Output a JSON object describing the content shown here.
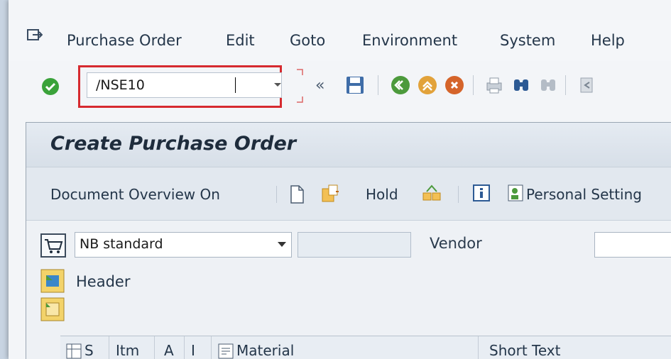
{
  "menu": {
    "items": [
      {
        "label": "Purchase Order"
      },
      {
        "label": "Edit"
      },
      {
        "label": "Goto"
      },
      {
        "label": "Environment"
      },
      {
        "label": "System"
      },
      {
        "label": "Help"
      }
    ]
  },
  "toolbar": {
    "command_value": "/NSE10",
    "highlight_color": "#d62a2f"
  },
  "page": {
    "title": "Create Purchase Order"
  },
  "app_toolbar": {
    "document_overview": "Document Overview On",
    "hold": "Hold",
    "personal_setting": "Personal Setting"
  },
  "form": {
    "doc_type": "NB standard",
    "vendor_label": "Vendor",
    "header_label": "Header"
  },
  "table": {
    "columns": [
      "S",
      "Itm",
      "A",
      "I",
      "Material",
      "Short Text"
    ]
  }
}
